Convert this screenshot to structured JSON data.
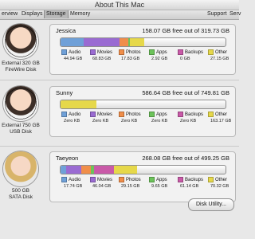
{
  "window": {
    "title": "About This Mac"
  },
  "toolbar": {
    "tabs": [
      "erview",
      "Displays",
      "Storage",
      "Memory",
      "Support",
      "Serv"
    ]
  },
  "colors": {
    "audio": "#6fa0d8",
    "movies": "#9a6bd2",
    "photos": "#f08e4a",
    "apps": "#6cc35a",
    "backups": "#c95aa8",
    "other": "#e6d84a",
    "free": "#f7f7f7"
  },
  "disks": [
    {
      "caption_line1": "External 320 GB",
      "caption_line2": "FireWire Disk",
      "name": "Jessica",
      "free_text": "158.07 GB free out of 319.73 GB",
      "used_fraction": 0.505,
      "segments": [
        {
          "label": "Audio",
          "size": "44.94 GB",
          "value": 44.94
        },
        {
          "label": "Movies",
          "size": "68.83 GB",
          "value": 68.83
        },
        {
          "label": "Photos",
          "size": "17.83 GB",
          "value": 17.83
        },
        {
          "label": "Apps",
          "size": "2.92 GB",
          "value": 2.92
        },
        {
          "label": "Backups",
          "size": "0 GB",
          "value": 0
        },
        {
          "label": "Other",
          "size": "27.15 GB",
          "value": 27.15
        }
      ]
    },
    {
      "caption_line1": "External 750 GB",
      "caption_line2": "USB Disk",
      "name": "Sunny",
      "free_text": "586.64 GB free out of 749.81 GB",
      "used_fraction": 0.218,
      "segments": [
        {
          "label": "Audio",
          "size": "Zero KB",
          "value": 0
        },
        {
          "label": "Movies",
          "size": "Zero KB",
          "value": 0
        },
        {
          "label": "Photos",
          "size": "Zero KB",
          "value": 0
        },
        {
          "label": "Apps",
          "size": "Zero KB",
          "value": 0
        },
        {
          "label": "Backups",
          "size": "Zero KB",
          "value": 0
        },
        {
          "label": "Other",
          "size": "163.17 GB",
          "value": 163.17
        }
      ]
    },
    {
      "caption_line1": "500 GB",
      "caption_line2": "SATA Disk",
      "name": "Taeyeon",
      "free_text": "268.08 GB free out of 499.25 GB",
      "used_fraction": 0.463,
      "segments": [
        {
          "label": "Audio",
          "size": "17.74 GB",
          "value": 17.74
        },
        {
          "label": "Movies",
          "size": "46.04 GB",
          "value": 46.04
        },
        {
          "label": "Photos",
          "size": "29.15 GB",
          "value": 29.15
        },
        {
          "label": "Apps",
          "size": "9.65 GB",
          "value": 9.65
        },
        {
          "label": "Backups",
          "size": "61.14 GB",
          "value": 61.14
        },
        {
          "label": "Other",
          "size": "70.32 GB",
          "value": 70.32
        }
      ]
    }
  ],
  "footer": {
    "disk_utility_label": "Disk Utility..."
  }
}
